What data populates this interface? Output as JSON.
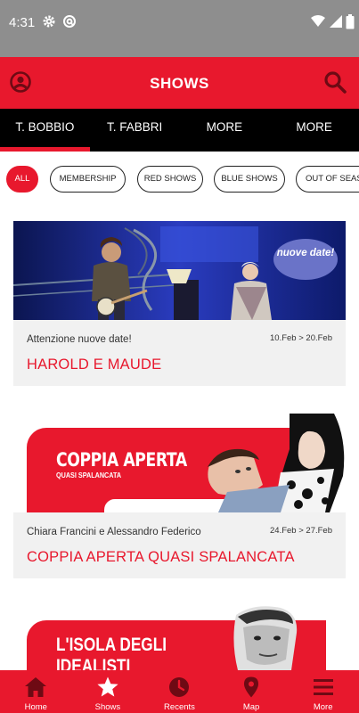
{
  "status_bar": {
    "time": "4:31",
    "icons": [
      "gear-icon",
      "at-icon",
      "wifi-icon",
      "signal-icon",
      "battery-icon"
    ]
  },
  "app_bar": {
    "title": "SHOWS",
    "left_icon": "user-icon",
    "right_icon": "search-icon"
  },
  "tabs": [
    {
      "label": "T. BOBBIO",
      "active": true
    },
    {
      "label": "T. FABBRI",
      "active": false
    },
    {
      "label": "MORE",
      "active": false
    },
    {
      "label": "MORE",
      "active": false
    }
  ],
  "filters": [
    {
      "label": "ALL",
      "active": true
    },
    {
      "label": "MEMBERSHIP",
      "active": false
    },
    {
      "label": "RED SHOWS",
      "active": false
    },
    {
      "label": "BLUE SHOWS",
      "active": false
    },
    {
      "label": "OUT OF SEASON",
      "active": false
    }
  ],
  "shows": [
    {
      "badge": "nuove date!",
      "subtitle": "Attenzione nuove date!",
      "dates": "10.Feb > 20.Feb",
      "name": "HAROLD E MAUDE"
    },
    {
      "poster_title": "COPPIA APERTA",
      "poster_subtitle": "QUASI SPALANCATA",
      "subtitle": "Chiara Francini e Alessandro Federico",
      "dates": "24.Feb > 27.Feb",
      "name": "COPPIA APERTA QUASI SPALANCATA"
    },
    {
      "poster_title_line1": "L'ISOLA DEGLI",
      "poster_title_line2": "IDEALISTI"
    }
  ],
  "bottom_nav": [
    {
      "label": "Home",
      "icon": "home-icon"
    },
    {
      "label": "Shows",
      "icon": "star-icon"
    },
    {
      "label": "Recents",
      "icon": "clock-icon"
    },
    {
      "label": "Map",
      "icon": "map-pin-icon"
    },
    {
      "label": "More",
      "icon": "menu-icon"
    }
  ],
  "colors": {
    "brand_red": "#e8182d",
    "tab_bar": "#000000",
    "status_bar": "#8e8e8e",
    "card_bg": "#f1f1f1"
  }
}
